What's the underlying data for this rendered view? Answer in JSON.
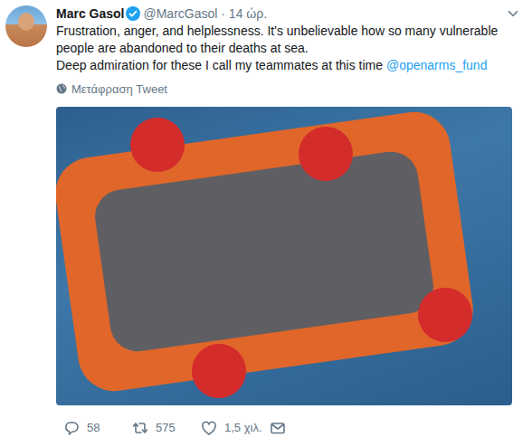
{
  "tweet": {
    "author": {
      "name": "Marc Gasol",
      "handle": "@MarcGasol",
      "verified": true
    },
    "separator": "·",
    "time": "14 ώρ.",
    "paragraphs": [
      {
        "parts": [
          {
            "text": "Frustration, anger, and helplessness. It's unbelievable how so many vulnerable people are abandoned to their deaths at sea.",
            "kind": "plain"
          }
        ]
      },
      {
        "parts": [
          {
            "text": "Deep admiration for these I call my teammates at this time ",
            "kind": "plain"
          },
          {
            "text": "@openarms_fund",
            "kind": "mention"
          }
        ]
      }
    ],
    "translate": "Μετάφραση Tweet"
  },
  "actions": [
    {
      "kind": "reply",
      "count": "58"
    },
    {
      "kind": "retweet",
      "count": "575"
    },
    {
      "kind": "like",
      "count": "1,5 χιλ."
    },
    {
      "kind": "message"
    }
  ]
}
